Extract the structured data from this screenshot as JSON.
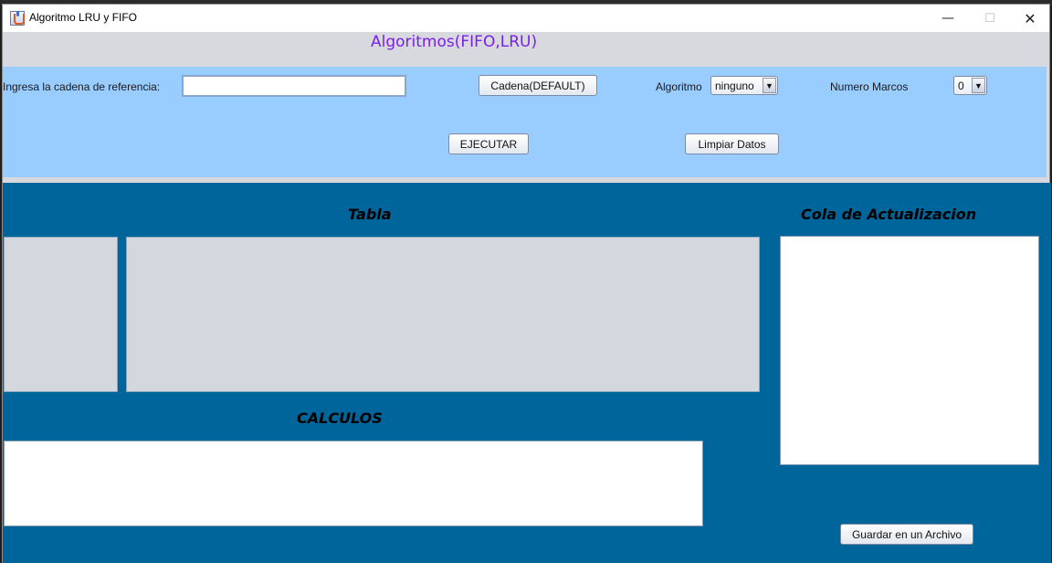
{
  "window": {
    "title": "Algoritmo LRU y FIFO",
    "icon": "java-cup-icon",
    "controls": {
      "minimize": "—",
      "maximize": "☐",
      "close": "✕"
    }
  },
  "heading": "Algoritmos(FIFO,LRU)",
  "form": {
    "reference_label": "Ingresa la cadena de referencia:",
    "reference_value": "",
    "default_button": "Cadena(DEFAULT)",
    "algorithm_label": "Algoritmo",
    "algorithm_selected": "ninguno",
    "frames_label": "Numero Marcos",
    "frames_selected": "0",
    "execute_button": "EJECUTAR",
    "clear_button": "Limpiar Datos"
  },
  "sections": {
    "table_title": "Tabla",
    "queue_title": "Cola de Actualizacion",
    "calc_title": "CALCULOS",
    "save_button": "Guardar en un Archivo"
  },
  "colors": {
    "heading": "#7a1fe6",
    "top_panel": "#99ccff",
    "bottom_panel": "#00659a",
    "table_area": "#d4d7de"
  }
}
